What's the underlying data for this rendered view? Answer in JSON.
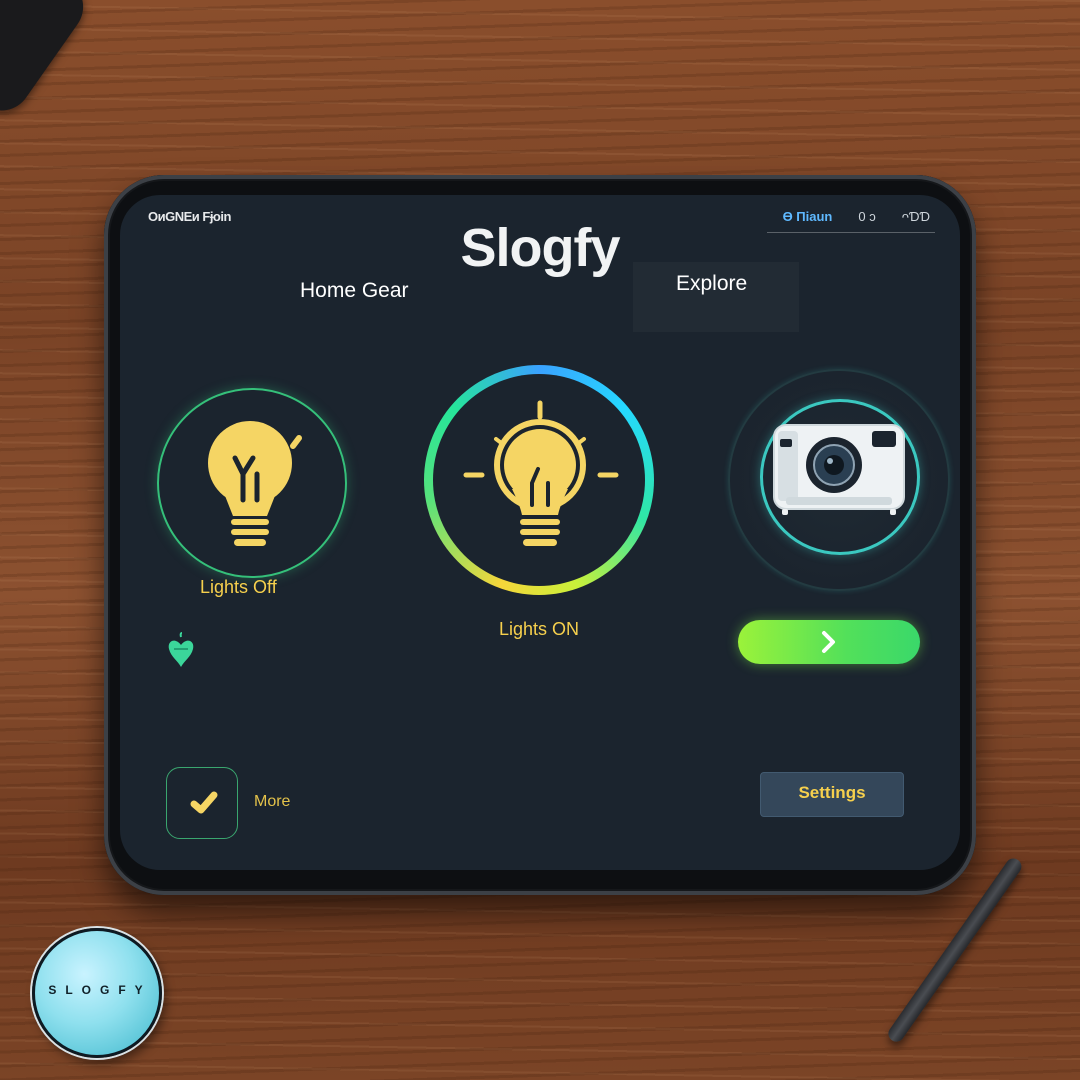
{
  "status_bar": {
    "left_text": "OᴎGNEᴎ Fɉoin",
    "right_items": [
      "Ө Пiaun",
      "0 ɔ",
      "ᴖƊƊ"
    ]
  },
  "app": {
    "title": "Slogfy"
  },
  "nav": {
    "home_label": "Home Gear",
    "explore_label": "Explore"
  },
  "devices": {
    "light_off": {
      "label": "Lights Off",
      "icon": "lightbulb-icon"
    },
    "light_on": {
      "label": "Lights ON",
      "icon": "lightbulb-glowing-icon"
    },
    "camera": {
      "icon": "projector-camera-icon"
    }
  },
  "actions": {
    "go_icon": "chevron-right-icon",
    "more_label": "More",
    "more_icon": "check-icon",
    "settings_label": "Settings",
    "small_icon": "heart-leaf-icon"
  },
  "brand_badge": {
    "text": "SLOGFY"
  },
  "colors": {
    "screen_bg": "#1b242e",
    "accent_yellow": "#f6d04d",
    "accent_green": "#52e05a",
    "accent_teal": "#3bc8c0",
    "ring_blue": "#3aa2ff"
  }
}
